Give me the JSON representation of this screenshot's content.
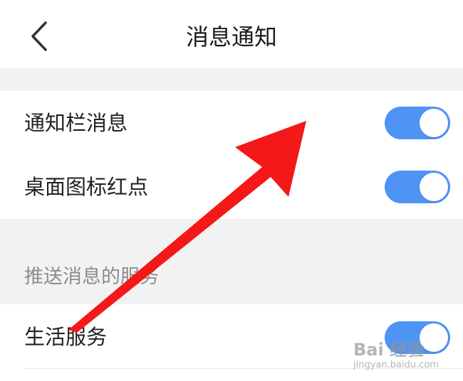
{
  "header": {
    "title": "消息通知",
    "back_icon": "chevron-left-icon"
  },
  "settings": {
    "notification_bar": {
      "label": "通知栏消息",
      "enabled": true
    },
    "desktop_badge": {
      "label": "桌面图标红点",
      "enabled": true
    }
  },
  "push_section": {
    "title": "推送消息的服务",
    "items": [
      {
        "label": "生活服务",
        "enabled": true
      }
    ]
  },
  "colors": {
    "toggle_on": "#4e94f5",
    "annotation_arrow": "#f41818",
    "section_bg": "#f2f2f2"
  },
  "watermark": {
    "logo": "Bai 经验",
    "url": "jingyan.baidu.com"
  }
}
